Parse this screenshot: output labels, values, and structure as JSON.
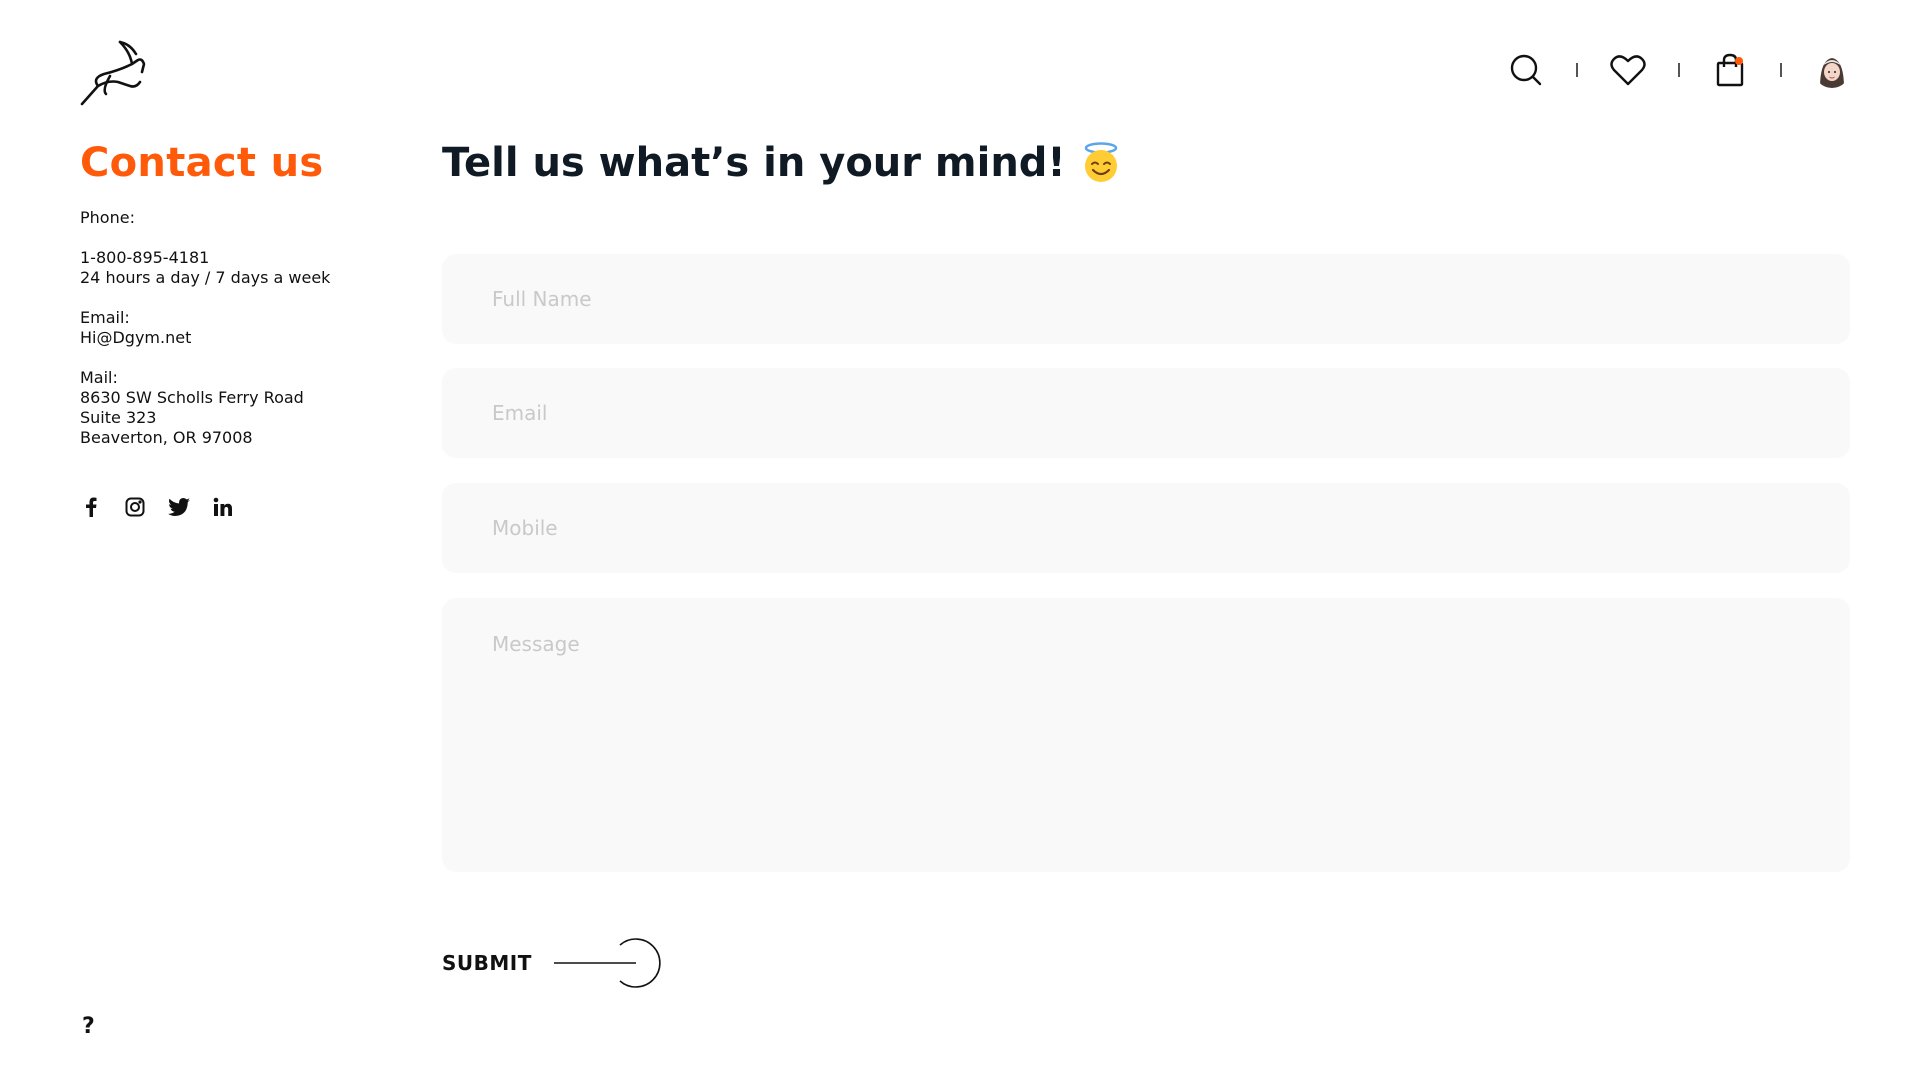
{
  "brand": {
    "logo_icon": "gazelle-logo-icon"
  },
  "header": {
    "icons": [
      "search-icon",
      "heart-icon",
      "shopping-bag-icon",
      "avatar"
    ],
    "cart_badge_color": "#ff5a0a"
  },
  "contact": {
    "title": "Contact us",
    "phone_label": "Phone:",
    "phone_number": "1-800-895-4181",
    "phone_hours": "24 hours a day / 7 days a week",
    "email_label": "Email:",
    "email_value": "Hi@Dgym.net",
    "mail_label": "Mail:",
    "mail_line1": "8630 SW Scholls Ferry Road",
    "mail_line2": "Suite 323",
    "mail_line3": "Beaverton, OR 97008",
    "socials": [
      "facebook-icon",
      "instagram-icon",
      "twitter-icon",
      "linkedin-icon"
    ]
  },
  "help_label": "?",
  "form": {
    "heading": "Tell us what’s in your mind!",
    "heading_emoji": "smiling-face-with-halo-icon",
    "full_name_placeholder": "Full Name",
    "email_placeholder": "Email",
    "mobile_placeholder": "Mobile",
    "message_placeholder": "Message",
    "submit_label": "SUBMIT"
  },
  "colors": {
    "accent": "#ff5a0a",
    "field_bg": "#f9f9f9",
    "heading": "#0f1a24"
  }
}
